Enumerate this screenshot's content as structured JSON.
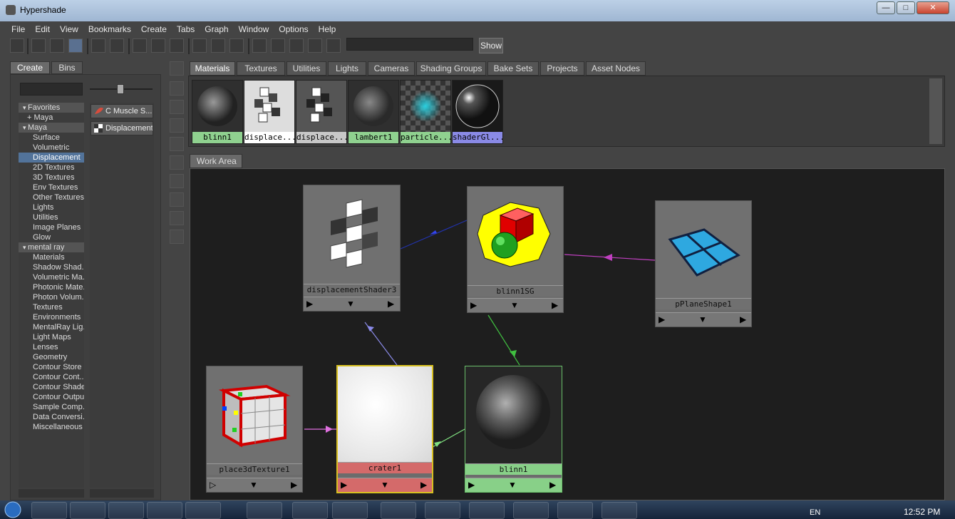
{
  "window": {
    "title": "Hypershade"
  },
  "menu": [
    "File",
    "Edit",
    "View",
    "Bookmarks",
    "Create",
    "Tabs",
    "Graph",
    "Window",
    "Options",
    "Help"
  ],
  "toolbar": {
    "show_label": "Show"
  },
  "left_tabs": [
    "Create",
    "Bins"
  ],
  "tree": [
    {
      "label": "Favorites",
      "kind": "hdr"
    },
    {
      "label": "+ Maya",
      "kind": "sub"
    },
    {
      "label": "Maya",
      "kind": "hdr"
    },
    {
      "label": "Surface",
      "kind": "item"
    },
    {
      "label": "Volumetric",
      "kind": "item"
    },
    {
      "label": "Displacement",
      "kind": "sel"
    },
    {
      "label": "2D Textures",
      "kind": "item"
    },
    {
      "label": "3D Textures",
      "kind": "item"
    },
    {
      "label": "Env Textures",
      "kind": "item"
    },
    {
      "label": "Other Textures",
      "kind": "item"
    },
    {
      "label": "Lights",
      "kind": "item"
    },
    {
      "label": "Utilities",
      "kind": "item"
    },
    {
      "label": "Image Planes",
      "kind": "item"
    },
    {
      "label": "Glow",
      "kind": "item"
    },
    {
      "label": "mental ray",
      "kind": "hdr"
    },
    {
      "label": "Materials",
      "kind": "item"
    },
    {
      "label": "Shadow Shad...",
      "kind": "item"
    },
    {
      "label": "Volumetric Ma...",
      "kind": "item"
    },
    {
      "label": "Photonic Mate...",
      "kind": "item"
    },
    {
      "label": "Photon Volum...",
      "kind": "item"
    },
    {
      "label": "Textures",
      "kind": "item"
    },
    {
      "label": "Environments",
      "kind": "item"
    },
    {
      "label": "MentalRay Lig...",
      "kind": "item"
    },
    {
      "label": "Light Maps",
      "kind": "item"
    },
    {
      "label": "Lenses",
      "kind": "item"
    },
    {
      "label": "Geometry",
      "kind": "item"
    },
    {
      "label": "Contour Store",
      "kind": "item"
    },
    {
      "label": "Contour Cont...",
      "kind": "item"
    },
    {
      "label": "Contour Shade...",
      "kind": "item"
    },
    {
      "label": "Contour Outpu...",
      "kind": "item"
    },
    {
      "label": "Sample Comp...",
      "kind": "item"
    },
    {
      "label": "Data Conversi...",
      "kind": "item"
    },
    {
      "label": "Miscellaneous",
      "kind": "item"
    }
  ],
  "node_list": [
    "C Muscle S...",
    "Displacement"
  ],
  "mat_tabs": [
    "Materials",
    "Textures",
    "Utilities",
    "Lights",
    "Cameras",
    "Shading Groups",
    "Bake Sets",
    "Projects",
    "Asset Nodes"
  ],
  "swatches": [
    {
      "label": "blinn1",
      "bg": "#8fd18f"
    },
    {
      "label": "displace...",
      "bg": "#ffffff"
    },
    {
      "label": "displace...",
      "bg": "#c8c8c8"
    },
    {
      "label": "lambert1",
      "bg": "#8fd18f"
    },
    {
      "label": "particle...",
      "bg": "#8fd18f"
    },
    {
      "label": "shaderGl...",
      "bg": "#8a8ae6"
    }
  ],
  "work_area": {
    "tab": "Work Area"
  },
  "nodes": [
    {
      "id": "displacementShader3",
      "label": "displacementShader3"
    },
    {
      "id": "blinn1SG",
      "label": "blinn1SG"
    },
    {
      "id": "pPlaneShape1",
      "label": "pPlaneShape1"
    },
    {
      "id": "place3dTexture1",
      "label": "place3dTexture1"
    },
    {
      "id": "crater1",
      "label": "crater1"
    },
    {
      "id": "blinn1",
      "label": "blinn1"
    }
  ],
  "taskbar": {
    "lang": "EN",
    "time": "12:52 PM"
  },
  "colors": {
    "selected": "#52739a",
    "panel": "#444444",
    "workarea": "#1e1e1e"
  }
}
